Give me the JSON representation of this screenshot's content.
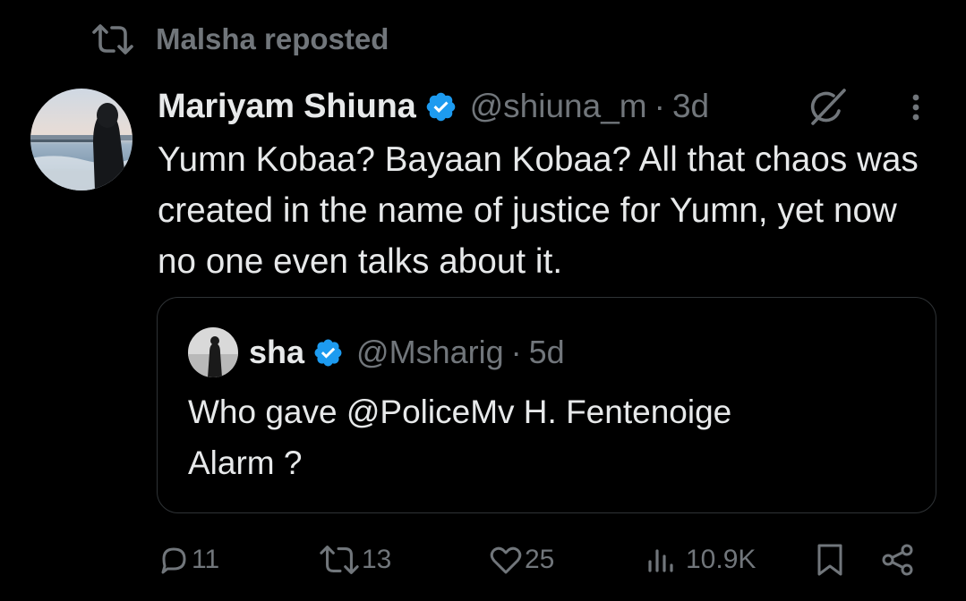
{
  "repost": {
    "label": "Malsha reposted",
    "icon": "repost-icon"
  },
  "tweet": {
    "author_name": "Mariyam Shiuna",
    "handle": "@shiuna_m",
    "separator": "·",
    "age": "3d",
    "text": "Yumn Kobaa? Bayaan Kobaa? All that chaos was created in the name of justice for Yumn, yet now no one even talks about it."
  },
  "quote": {
    "author_name": "sha",
    "handle": "@Msharig",
    "separator": "·",
    "age": "5d",
    "text_line1": "Who gave @PoliceMv H. Fentenoige",
    "text_line2": "Alarm ?"
  },
  "actions": {
    "replies": "11",
    "reposts": "13",
    "likes": "25",
    "views": "10.9K"
  },
  "colors": {
    "background": "#000000",
    "text": "#e7e9ea",
    "muted": "#71767b",
    "verified": "#1d9bf0",
    "border": "#2f3336"
  }
}
